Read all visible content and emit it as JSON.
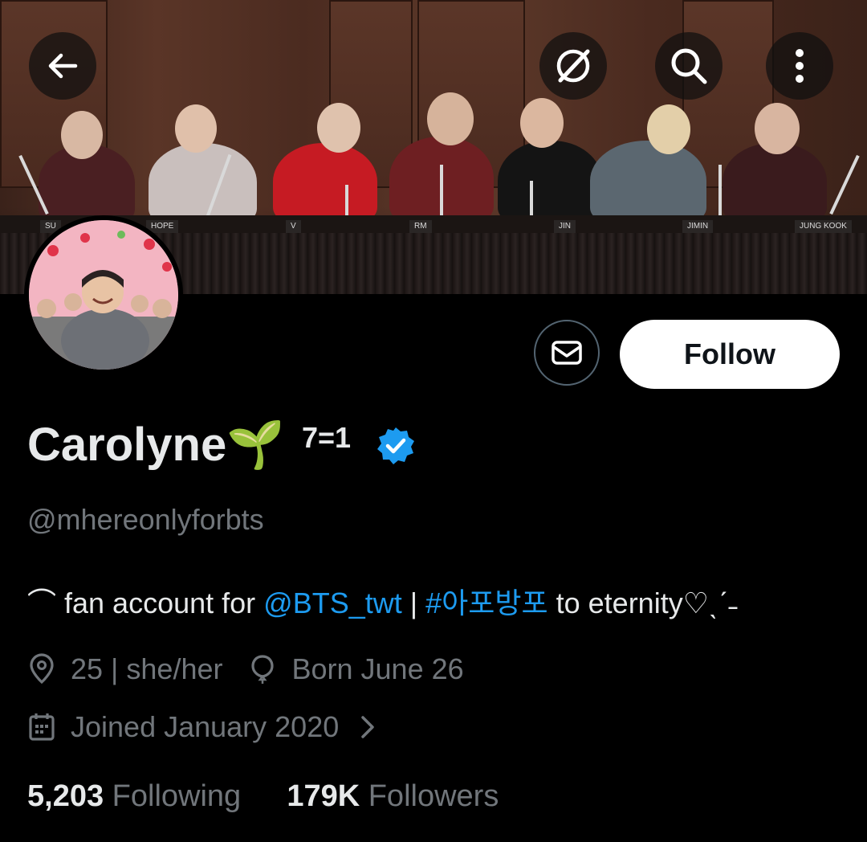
{
  "header": {
    "back_icon": "arrow-left-icon",
    "translate_icon": "grok-slash-icon",
    "search_icon": "search-icon",
    "more_icon": "more-vertical-icon"
  },
  "banner": {
    "name_plates": [
      "SU",
      "HOPE",
      "V",
      "RM",
      "JIN",
      "JIMIN",
      "JUNG KOOK"
    ]
  },
  "profile": {
    "display_name": "Carolyne🌱",
    "name_suffix": "7=1",
    "verified": true,
    "handle": "@mhereonlyforbts",
    "bio_prefix": "⌒ fan account for ",
    "bio_mention": "@BTS_twt",
    "bio_sep": " | ",
    "bio_hashtag": "#아포방포",
    "bio_suffix": " to eternity♡ˎˊ˗",
    "location": "25 | she/her",
    "birthday": "Born June 26",
    "joined": "Joined January 2020",
    "following_count": "5,203",
    "following_label": "Following",
    "followers_count": "179K",
    "followers_label": "Followers"
  },
  "actions": {
    "follow_label": "Follow",
    "message_icon": "mail-icon"
  },
  "colors": {
    "accent": "#1d9bf0",
    "muted": "#71767b",
    "background": "#000000"
  }
}
